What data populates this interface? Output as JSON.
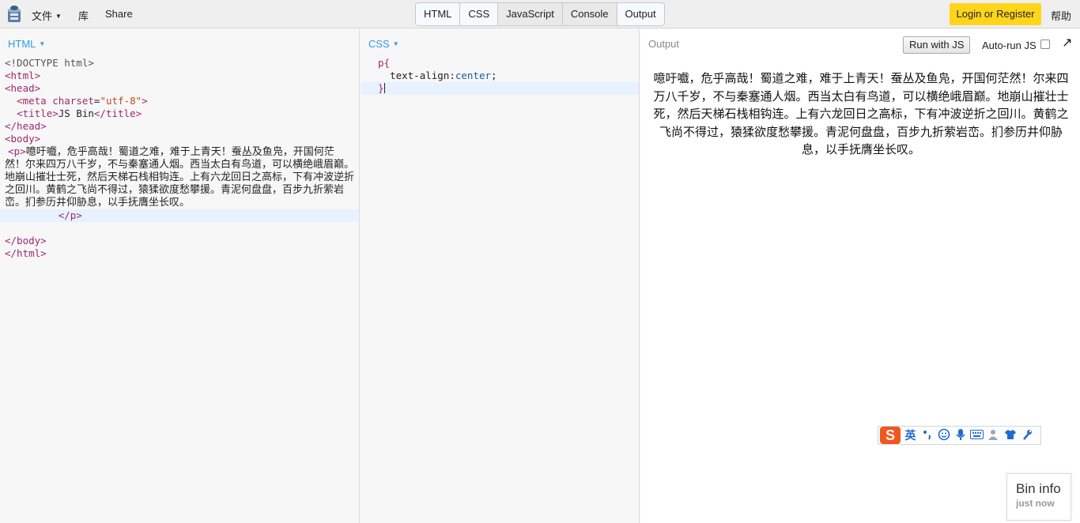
{
  "topbar": {
    "menu_file": "文件",
    "menu_library": "库",
    "menu_share": "Share",
    "tabs": [
      "HTML",
      "CSS",
      "JavaScript",
      "Console",
      "Output"
    ],
    "login": "Login or Register",
    "help": "帮助"
  },
  "html_panel": {
    "label": "HTML",
    "lines": {
      "doctype": "<!DOCTYPE html>",
      "html_open": "<html>",
      "head_open": "<head>",
      "meta_tag_open": "<meta",
      "meta_attr": "charset",
      "meta_eq": "=",
      "meta_val": "\"utf-8\"",
      "meta_close": ">",
      "title_open": "<title>",
      "title_text": "JS Bin",
      "title_close": "</title>",
      "head_close": "</head>",
      "body_open": "<body>",
      "p_open": "<p>",
      "p_text": "噫吁嚱，危乎高哉！蜀道之难，难于上青天！蚕丛及鱼凫，开国何茫然！尔来四万八千岁，不与秦塞通人烟。西当太白有鸟道，可以横绝峨眉巅。地崩山摧壮士死，然后天梯石栈相钩连。上有六龙回日之高标，下有冲波逆折之回川。黄鹤之飞尚不得过，猿猱欲度愁攀援。青泥何盘盘，百步九折萦岩峦。扪参历井仰胁息，以手抚膺坐长叹。",
      "p_close": "</p>",
      "body_close": "</body>",
      "html_close": "</html>"
    }
  },
  "css_panel": {
    "label": "CSS",
    "selector": "p{",
    "property": "text-align",
    "colon": ":",
    "value": "center",
    "semicolon": ";",
    "close": "}"
  },
  "output_panel": {
    "label": "Output",
    "run_button": "Run with JS",
    "autorun_label": "Auto-run JS",
    "autorun_checked": false,
    "popout_icon": "↗",
    "rendered_text": "噫吁嚱，危乎高哉！蜀道之难，难于上青天！蚕丛及鱼凫，开国何茫然！尔来四万八千岁，不与秦塞通人烟。西当太白有鸟道，可以横绝峨眉巅。地崩山摧壮士死，然后天梯石栈相钩连。上有六龙回日之高标，下有冲波逆折之回川。黄鹤之飞尚不得过，猿猱欲度愁攀援。青泥何盘盘，百步九折萦岩峦。扪参历井仰胁息，以手抚膺坐长叹。"
  },
  "ime_toolbar": {
    "logo": "S",
    "lang": "英",
    "icons": [
      "punctuation-icon",
      "emoji-icon",
      "microphone-icon",
      "keyboard-icon",
      "user-icon",
      "skin-icon",
      "settings-icon"
    ]
  },
  "bin_info": {
    "title": "Bin info",
    "subtitle": "just now"
  }
}
